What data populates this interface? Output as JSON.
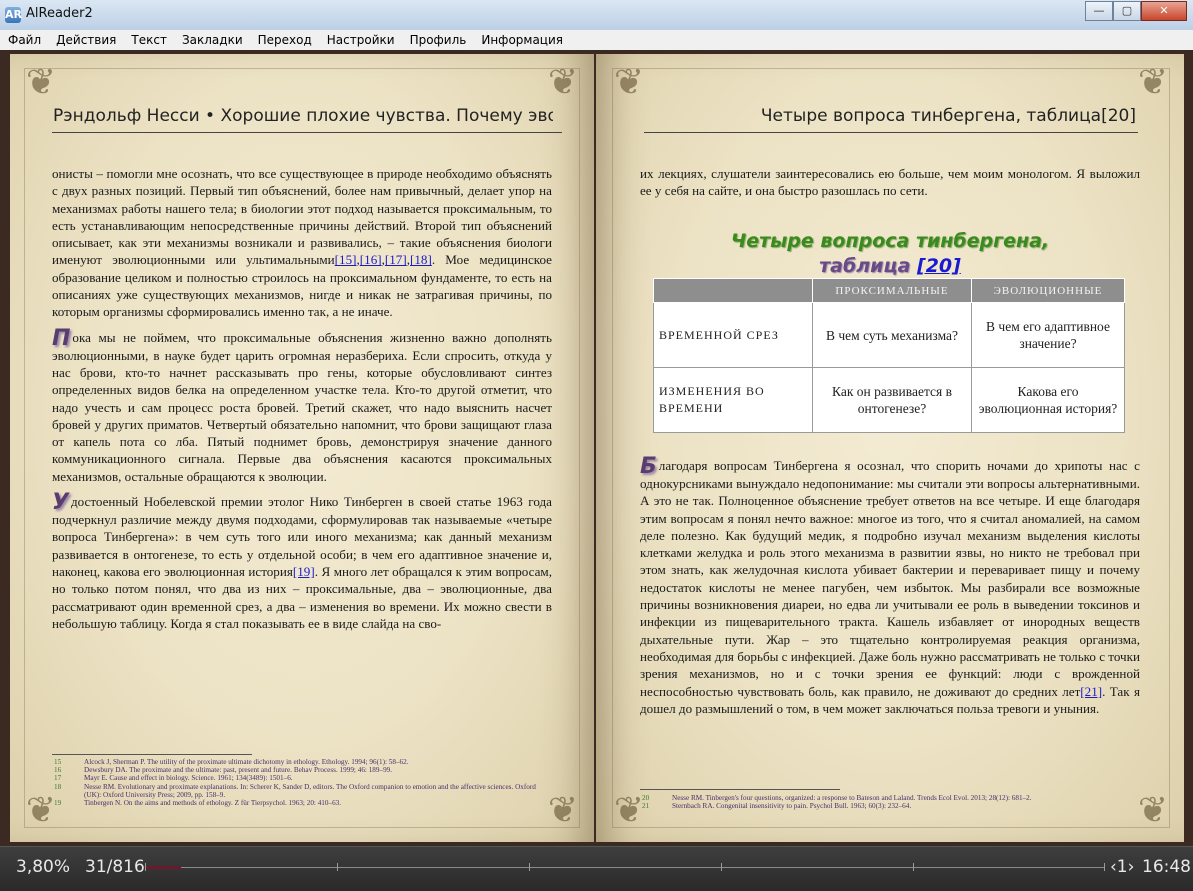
{
  "window": {
    "title": "AlReader2",
    "minimize": "—",
    "maximize": "▢",
    "close": "✕",
    "app_icon": "AR"
  },
  "menu": [
    "Файл",
    "Действия",
    "Текст",
    "Закладки",
    "Переход",
    "Настройки",
    "Профиль",
    "Информация"
  ],
  "left_page": {
    "running_head": "Рэндольф Несси • Хорошие плохие чувства. Почему эволюция д..",
    "p1_a": "онисты – помогли мне осознать, что все существующее в природе необходимо объяснять с двух разных позиций. Первый тип объяснений, более нам привычный, делает упор на механизмах работы нашего тела; в биологии этот подход называется проксимальным, то есть устанавливающим непосредственные причины действий. Второй тип объяснений описывает, как эти механизмы возникали и развивались, – такие объяснения биологи именуют эволюционными или ультимальными",
    "refs1": [
      "[15]",
      "[16]",
      "[17]",
      "[18]"
    ],
    "p1_b": ". Мое медицинское образование целиком и полностью строилось на проксимальном фундаменте, то есть на описаниях уже существующих механизмов, нигде и никак не затрагивая причины, по которым организмы сформировались именно так, а не иначе.",
    "p2_cap": "П",
    "p2": "ока мы не поймем, что проксимальные объяснения жизненно важно дополнять эволюционными, в науке будет царить огромная неразбериха. Если спросить, откуда у нас брови, кто-то начнет рассказывать про гены, которые обусловливают синтез определенных видов белка на определенном участке тела. Кто-то другой отметит, что надо учесть и сам процесс роста бровей. Третий скажет, что надо выяснить насчет бровей у других приматов. Четвертый обязательно напомнит, что брови защищают глаза от капель пота со лба. Пятый поднимет бровь, демонстрируя значение данного коммуникационного сигнала. Первые два объяснения касаются проксимальных механизмов, остальные обращаются к эволюции.",
    "p3_cap": "У",
    "p3_a": "достоенный Нобелевской премии этолог Нико Тинберген в своей статье 1963 года подчеркнул различие между двумя подходами, сформулировав так называемые «четыре вопроса Тинбергена»: в чем суть того или иного механизма; как данный механизм развивается в онтогенезе, то есть у отдельной особи; в чем его адаптивное значение и, наконец, какова его эволюционная история",
    "ref19": "[19]",
    "p3_b": ". Я много лет обращался к этим вопросам, но только потом понял, что два из них – проксимальные, два – эволюционные, два рассматривают один временной срез, а два – изменения во времени. Их можно свести в небольшую таблицу. Когда я стал показывать ее в виде слайда на сво-",
    "footnotes": [
      {
        "n": "15",
        "t": "Alcock J, Sherman P. The utility of the proximate ultimate dichotomy in ethology. Ethology. 1994; 96(1): 58–62."
      },
      {
        "n": "16",
        "t": "Dewsbury DA. The proximate and the ultimate: past, present and future. Behav Process. 1999; 46: 189–99."
      },
      {
        "n": "17",
        "t": "Mayr E. Cause and effect in biology. Science. 1961; 134(3489): 1501–6."
      },
      {
        "n": "18",
        "t": "Nesse RM. Evolutionary and proximate explanations. In: Scherer K, Sander D, editors. The Oxford companion to emotion and the affective sciences. Oxford (UK): Oxford University Press; 2009, pp. 158–9."
      },
      {
        "n": "19",
        "t": "Tinbergen N. On the aims and methods of ethology. Z für Tierpsychol. 1963; 20: 410–63."
      }
    ]
  },
  "right_page": {
    "running_head": "Четыре вопроса тинбергена, таблица[20]",
    "p0": "их лекциях, слушатели заинтересовались ею больше, чем моим монологом. Я выложил ее у себя на сайте, и она быстро разошлась по сети.",
    "table_title_1": "Четыре вопроса тинбергена,",
    "table_title_2": "таблица",
    "table_ref": "[20]",
    "table": {
      "col1": "ПРОКСИМАЛЬНЫЕ",
      "col2": "ЭВОЛЮЦИОННЫЕ",
      "row1_head": "ВРЕМЕННОЙ СРЕЗ",
      "row1_c1": "В чем суть механизма?",
      "row1_c2": "В чем его адаптивное значение?",
      "row2_head": "ИЗМЕНЕНИЯ ВО ВРЕМЕНИ",
      "row2_c1": "Как он развивается в онтогенезе?",
      "row2_c2": "Какова его эволюционная история?"
    },
    "p1_cap": "Б",
    "p1_a": "лагодаря вопросам Тинбергена я осознал, что спорить ночами до хрипоты нас с однокурсниками вынуждало недопонимание: мы считали эти вопросы альтернативными. А это не так. Полноценное объяснение требует ответов на все четыре. И еще благодаря этим вопросам я понял нечто важное: многое из того, что я считал аномалией, на самом деле полезно. Как будущий медик, я подробно изучал механизм выделения кислоты клетками желудка и роль этого механизма в развитии язвы, но никто не требовал при этом знать, как желудочная кислота убивает бактерии и переваривает пищу и почему недостаток кислоты не менее пагубен, чем избыток. Мы разбирали все возможные причины возникновения диареи, но едва ли учитывали ее роль в выведении токсинов и инфекции из пищеварительного тракта. Кашель избавляет от инородных веществ дыхательные пути. Жар – это тщательно контролируемая реакция организма, необходимая для борьбы с инфекцией. Даже боль нужно рассматривать не только с точки зрения механизмов, но и с точки зрения ее функций: люди с врожденной неспособностью чувствовать боль, как правило, не доживают до средних лет",
    "ref21": "[21]",
    "p1_b": ". Так я дошел до размышлений о том, в чем может заключаться польза тревоги и уныния.",
    "footnotes": [
      {
        "n": "20",
        "t": "Nesse RM. Tinbergen's four questions, organized: a response to Bateson and Laland. Trends Ecol Evol. 2013; 28(12): 681–2."
      },
      {
        "n": "21",
        "t": "Sternbach RA. Congenital insensitivity to pain. Psychol Bull. 1963; 60(3): 232–64."
      }
    ]
  },
  "status": {
    "percent": "3,80%",
    "page": "31/816",
    "progress": 0.038,
    "chapter": "‹1›",
    "time": "16:48"
  },
  "ornament": "❦"
}
